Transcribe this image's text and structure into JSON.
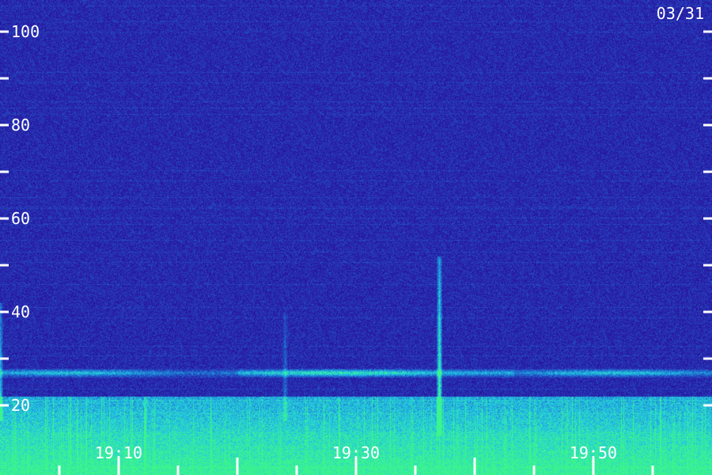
{
  "date_label": "03/31",
  "chart_data": {
    "type": "heatmap",
    "title": "",
    "xlabel": "",
    "ylabel": "",
    "x_range": [
      "19:00",
      "19:59"
    ],
    "ylim": [
      10,
      105
    ],
    "x_tick_labels": [
      "19:10",
      "19:30",
      "19:50"
    ],
    "x_minor_ticks": [
      "19:05",
      "19:10",
      "19:15",
      "19:20",
      "19:25",
      "19:30",
      "19:35",
      "19:40",
      "19:45",
      "19:50",
      "19:55"
    ],
    "y_tick_values": [
      20,
      30,
      40,
      50,
      60,
      70,
      80,
      90,
      100
    ],
    "y_tick_labels": [
      20,
      40,
      60,
      80,
      100
    ],
    "features": {
      "noise_floor_band": [
        10,
        22
      ],
      "horizontal_band": {
        "y": 27,
        "x_from": "19:00",
        "x_to": "19:59"
      },
      "vertical_bursts": [
        {
          "x": "19:37",
          "y_from": 17,
          "y_to": 52,
          "strength": "strong"
        },
        {
          "x": "19:00",
          "y_from": 20,
          "y_to": 42,
          "strength": "weak"
        },
        {
          "x": "19:24",
          "y_from": 20,
          "y_to": 40,
          "strength": "faint"
        }
      ]
    },
    "colormap": [
      "#14005a",
      "#2a1aa8",
      "#1f6fd0",
      "#22c8e6",
      "#3cf58c"
    ]
  }
}
